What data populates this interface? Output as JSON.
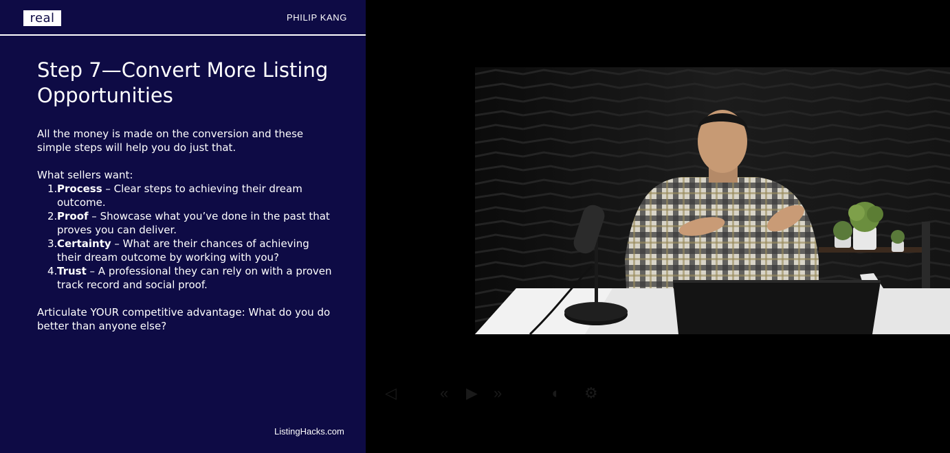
{
  "slide": {
    "logo": "real",
    "presenter": "PHILIP KANG",
    "title": "Step 7—Convert More Listing Opportunities",
    "intro": "All the money is made on the conversion and these simple steps will help you do just that.",
    "sellers_heading": "What sellers want:",
    "steps": [
      {
        "num": "1.",
        "label": "Process",
        "text": " – Clear steps to achieving their dream outcome."
      },
      {
        "num": "2.",
        "label": "Proof",
        "text": " – Showcase what you’ve done in the past that proves you can deliver."
      },
      {
        "num": "3.",
        "label": "Certainty",
        "text": " – What are their chances of achieving their dream outcome by working with you?"
      },
      {
        "num": "4.",
        "label": "Trust",
        "text": " – A professional they can rely on with a proven track record and social proof."
      }
    ],
    "closing": "Articulate YOUR competitive advantage:  What do you do better than anyone else?",
    "footer": "ListingHacks.com"
  },
  "player": {
    "icons": [
      "rewind-icon",
      "play-icon",
      "fast-forward-icon"
    ]
  },
  "colors": {
    "slide_background": "#0e0b45",
    "text": "#ffffff"
  }
}
